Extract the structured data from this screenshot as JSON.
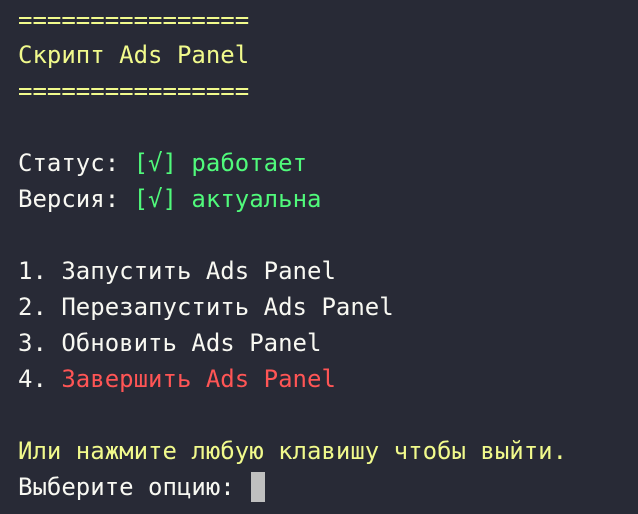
{
  "header": {
    "rule_top": "================",
    "title": "Скрипт Ads Panel",
    "rule_bottom": "================"
  },
  "status": {
    "label": "Статус:",
    "check": "[√]",
    "value": "работает"
  },
  "version": {
    "label": "Версия:",
    "check": "[√]",
    "value": "актуальна"
  },
  "menu": {
    "items": [
      {
        "num": "1.",
        "label": "Запустить Ads Panel"
      },
      {
        "num": "2.",
        "label": "Перезапустить Ads Panel"
      },
      {
        "num": "3.",
        "label": "Обновить Ads Panel"
      },
      {
        "num": "4.",
        "label": "Завершить Ads Panel"
      }
    ]
  },
  "footer": {
    "hint": "Или нажмите любую клавишу чтобы выйти.",
    "prompt": "Выберите опцию:"
  },
  "colors": {
    "background": "#282a36",
    "text": "#f8f8f2",
    "yellow": "#f1fa8c",
    "green": "#50fa7b",
    "red": "#ff5555",
    "cursor": "#bfbfbf"
  }
}
